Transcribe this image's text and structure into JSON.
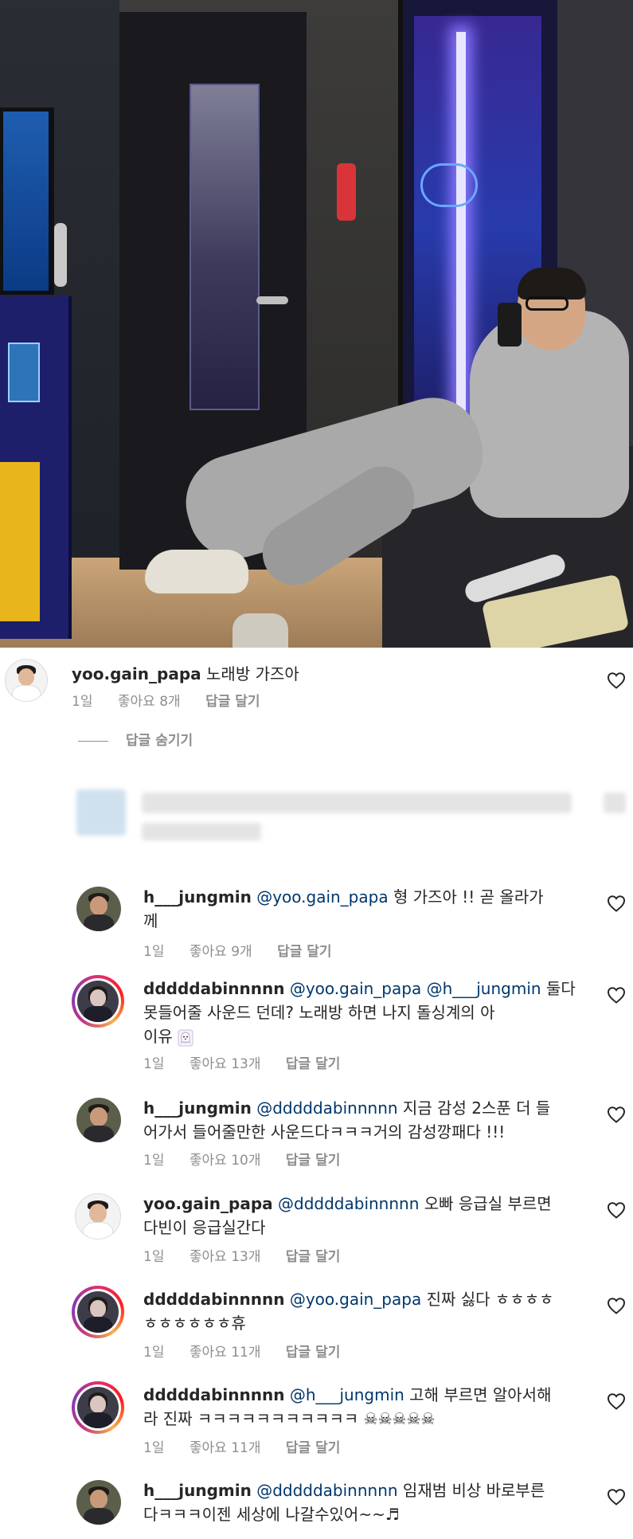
{
  "top_comment": {
    "username": "yoo.gain_papa",
    "text": "노래방 가즈아",
    "time": "1일",
    "likes": "좋아요 8개",
    "reply": "답글 달기"
  },
  "hide_replies_label": "답글 숨기기",
  "replies": [
    {
      "username": "h___jungmin",
      "mentions": [
        "@yoo.gain_papa"
      ],
      "line1": "형 가즈아 !! 곧 올라가",
      "line2": "께",
      "time": "1일",
      "likes": "좋아요 9개",
      "reply": "답글 달기"
    },
    {
      "username": "dddddabinnnnn",
      "mentions": [
        "@yoo.gain_papa",
        "@h___jungmin"
      ],
      "line1_tail": "둘다",
      "line2": "못들어줄 사운드 던데? 노래방 하면 나지 돌싱계의 아",
      "line3": "이유",
      "time": "1일",
      "likes": "좋아요 13개",
      "reply": "답글 달기"
    },
    {
      "username": "h___jungmin",
      "mentions": [
        "@dddddabinnnnn"
      ],
      "line1_tail": "지금 감성 2스푼 더 들",
      "line2": "어가서 들어줄만한 사운드다ㅋㅋㅋ거의 감성깡패다 !!!",
      "time": "1일",
      "likes": "좋아요 10개",
      "reply": "답글 달기"
    },
    {
      "username": "yoo.gain_papa",
      "mentions": [
        "@dddddabinnnnn"
      ],
      "line1_tail": "오빠 응급실 부르면",
      "line2": "다빈이 응급실간다",
      "time": "1일",
      "likes": "좋아요 13개",
      "reply": "답글 달기"
    },
    {
      "username": "dddddabinnnnn",
      "mentions": [
        "@yoo.gain_papa"
      ],
      "line1_tail": "진짜 싫다 ㅎㅎㅎㅎ",
      "line2": "ㅎㅎㅎㅎㅎㅎ휴",
      "time": "1일",
      "likes": "좋아요 11개",
      "reply": "답글 달기"
    },
    {
      "username": "dddddabinnnnn",
      "mentions": [
        "@h___jungmin"
      ],
      "line1_tail": "고해 부르면 알아서해",
      "line2": "라 진짜 ㅋㅋㅋㅋㅋㅋㅋㅋㅋㅋㅋ ☠☠☠☠☠",
      "time": "1일",
      "likes": "좋아요 11개",
      "reply": "답글 달기"
    },
    {
      "username": "h___jungmin",
      "mentions": [
        "@dddddabinnnnn"
      ],
      "line1_tail": "임재범 비상 바로부른",
      "line2": "다ㅋㅋㅋ이젠 세상에 나갈수있어~~♬"
    }
  ],
  "icons": {
    "heart": "heart-outline-icon",
    "ghost": "ghost-emoji-icon",
    "note": "music-note-emoji-icon"
  },
  "colors": {
    "text": "#262626",
    "meta": "#8e8e8e",
    "mention": "#00376b"
  }
}
